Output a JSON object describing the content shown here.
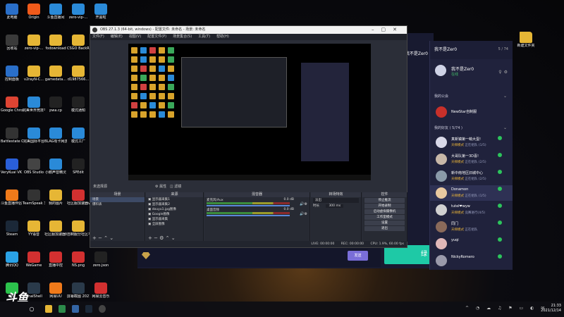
{
  "desktop": {
    "col1": [
      "此电脑",
      "回收站",
      "控制面板",
      "Google Chrome",
      "Battlestate Games L...",
      "VeryKuai VK 加速器",
      "斗鱼直播伴侣 2021",
      "Steam",
      "腾讯QQ",
      "微信"
    ],
    "col2": [
      "Origin",
      "zero-vip-...",
      "v2rayN-C...",
      "完美世界竞技平台",
      "完美国际平台",
      "OBS Studio",
      "TeamSpeak 3",
      "YY语音",
      "WeGame",
      "FinalShell"
    ],
    "col3": [
      "斗鱼直播间",
      "fodownload",
      "gamedata...",
      "pwa.cp",
      "BLAG有卡网游加速器",
      "小鹅声音精灵",
      "我的图片",
      "社区服加速器绿色便携版",
      "直播中控",
      "网易UU"
    ],
    "col4": [
      "zero-vip-...",
      "CSGO BackRP's...",
      "d1987566...",
      "模式通知",
      "模式工厂",
      "SPEdit",
      "社区服加速器v...zip",
      "自制服分社区平台...",
      "NS.png",
      "屏幕截图 2021-12-1..."
    ],
    "col5": [
      "开黑啦",
      "",
      "",
      "",
      "",
      "",
      "",
      "",
      "zero.json",
      "网易云音乐"
    ],
    "right_folder": "新建文件夹"
  },
  "obs": {
    "title": "OBS 27.1.3 (64-bit, windows) - 配置文件: 未命名 - 场景: 未命名",
    "menu": [
      "文件(F)",
      "编辑(E)",
      "视图(V)",
      "配置文件(P)",
      "场景集合(S)",
      "工具(T)",
      "帮助(H)"
    ],
    "no_source": "未选择源",
    "props_btn": "属性",
    "filters_btn": "滤镜",
    "scenes_header": "场景",
    "scenes": [
      "场景",
      "爆料表"
    ],
    "sources_header": "来源",
    "sources": [
      "显示器采集1",
      "显示器采集2",
      "douyu1.jpg图像",
      "Google图像",
      "显示器采集",
      "全屏图像"
    ],
    "mixer_header": "混音器",
    "tracks": [
      {
        "name": "麦克风/Aux",
        "db": "0.0 dB"
      },
      {
        "name": "桌面音频",
        "db": "0.0 dB"
      }
    ],
    "transition_header": "转场特效",
    "transition_value": "淡出",
    "duration_label": "时长",
    "duration_value": "300 ms",
    "controls_header": "控件",
    "controls": [
      "停止推流",
      "开始录制",
      "启动虚拟摄像机",
      "工作室模式",
      "设置",
      "退出"
    ],
    "status": {
      "live": "LIVE: 00:00:00",
      "rec": "REC: 00:00:00",
      "cpu": "CPU: 1.9%, 60.00 fps"
    }
  },
  "chat": {
    "top_user": "我不是Zer0",
    "send_label": "发送",
    "green_label": "绿",
    "count": "5 / 74"
  },
  "friends_panel": {
    "me_name": "我不是Zer0",
    "me_status": "在线",
    "my_guild": "我的公会",
    "guild": "NewStar自制服",
    "my_friends": "我的好友",
    "friends_count": "( 5/74 )",
    "friends": [
      {
        "name": "真新镇第一萌大蛋!",
        "game": "天梯模式",
        "detail": "正在组队 (1/5)"
      },
      {
        "name": "大哥队第一3D喜!",
        "game": "天梯模式",
        "detail": "正在组队 (2/5)"
      },
      {
        "name": "新中南地区旧城中心",
        "game": "天梯模式",
        "detail": "正在组队 (2/5)"
      },
      {
        "name": "Donamon",
        "game": "天梯模式",
        "detail": "正在组队 (1/5)"
      },
      {
        "name": "tutel❤wyw",
        "game": "天梯模式",
        "detail": "竞赛进行(4/5)"
      },
      {
        "name": "同门",
        "game": "天梯模式",
        "detail": "正在组队"
      },
      {
        "name": "yuqi",
        "game": "",
        "detail": ""
      },
      {
        "name": "NickyRomero",
        "game": "",
        "detail": ""
      }
    ]
  },
  "taskbar": {
    "time": "21:33",
    "date": "2021/12/14"
  },
  "watermark": "斗鱼",
  "colors": {
    "obs_bg": "#2b2e38",
    "chat_bg": "#181a30",
    "accent_green": "#1ec9a6",
    "send_purple": "#7a6ed8"
  }
}
